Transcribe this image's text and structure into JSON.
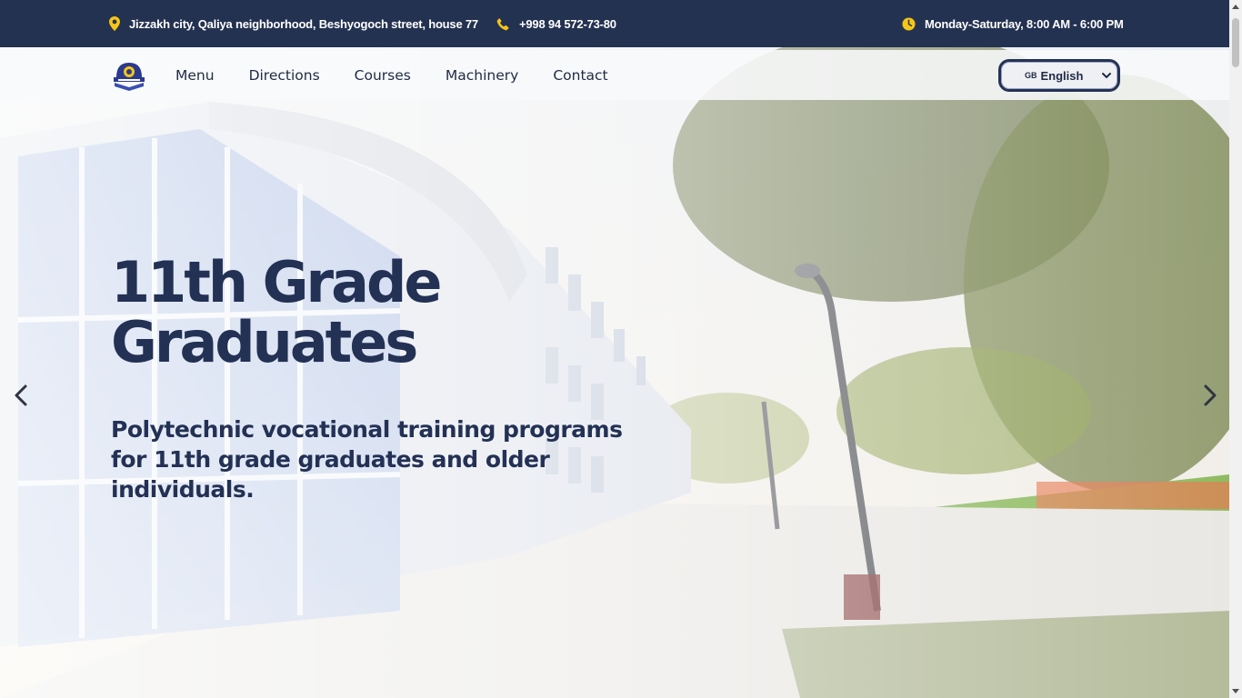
{
  "topbar": {
    "address": "Jizzakh city, Qaliya neighborhood, Beshyogoch street, house 77",
    "address_icon": "map-pin-icon",
    "phone": "+998 94 572-73-80",
    "phone_icon": "phone-icon",
    "hours": "Monday-Saturday, 8:00 AM - 6:00 PM",
    "hours_icon": "clock-icon",
    "background": "#243251",
    "icon_color": "#f5c518"
  },
  "nav": {
    "links": [
      "Menu",
      "Directions",
      "Courses",
      "Machinery",
      "Contact"
    ],
    "language": {
      "flag": "GB",
      "label": "English"
    }
  },
  "hero": {
    "title": "11th Grade Graduates",
    "subtitle": "Polytechnic vocational training programs for 11th grade graduates and older individuals.",
    "text_color": "#233155"
  }
}
